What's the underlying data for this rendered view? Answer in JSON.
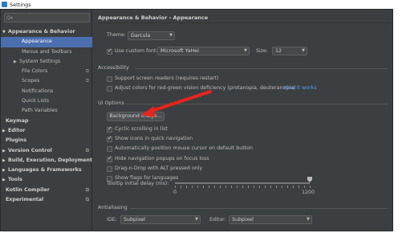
{
  "window": {
    "title": "Settings"
  },
  "search": {
    "placeholder": "Q▾"
  },
  "sidebar": {
    "items": [
      {
        "label": "Appearance & Behavior",
        "arrow": "▼",
        "level": 0,
        "bold": true
      },
      {
        "label": "Appearance",
        "level": 1,
        "selected": true
      },
      {
        "label": "Menus and Toolbars",
        "level": 1
      },
      {
        "label": "System Settings",
        "arrow": "▶",
        "level": 1
      },
      {
        "label": "File Colors",
        "level": 1,
        "project": true
      },
      {
        "label": "Scopes",
        "level": 1,
        "project": true
      },
      {
        "label": "Notifications",
        "level": 1
      },
      {
        "label": "Quick Lists",
        "level": 1
      },
      {
        "label": "Path Variables",
        "level": 1
      },
      {
        "label": "Keymap",
        "level": 0,
        "bold": true
      },
      {
        "label": "Editor",
        "arrow": "▶",
        "level": 0,
        "bold": true
      },
      {
        "label": "Plugins",
        "level": 0,
        "bold": true
      },
      {
        "label": "Version Control",
        "arrow": "▶",
        "level": 0,
        "bold": true,
        "project": true
      },
      {
        "label": "Build, Execution, Deployment",
        "arrow": "▶",
        "level": 0,
        "bold": true
      },
      {
        "label": "Languages & Frameworks",
        "arrow": "▶",
        "level": 0,
        "bold": true
      },
      {
        "label": "Tools",
        "arrow": "▶",
        "level": 0,
        "bold": true
      },
      {
        "label": "Kotlin Compiler",
        "level": 0,
        "bold": true,
        "project": true
      },
      {
        "label": "Experimental",
        "level": 0,
        "bold": true,
        "project": true
      }
    ],
    "project_glyph": "⧉"
  },
  "breadcrumb": {
    "text": "Appearance & Behavior  ›  Appearance"
  },
  "theme": {
    "label": "Theme:",
    "value": "Darcula"
  },
  "custom_font": {
    "label": "Use custom font:",
    "checked": true,
    "value": "Microsoft YaHei",
    "size_label": "Size:",
    "size_value": "12"
  },
  "accessibility": {
    "title": "Accessibility",
    "screen_readers": {
      "label": "Support screen readers (requires restart)",
      "checked": false
    },
    "color_deficiency": {
      "label": "Adjust colors for red-green vision deficiency (protanopia, deuteranopia)",
      "checked": false
    },
    "how_it_works": "How it works"
  },
  "ui_options": {
    "title": "UI Options",
    "background_button": "Background Image...",
    "options": [
      {
        "label": "Cyclic scrolling in list",
        "checked": true
      },
      {
        "label": "Show icons in quick navigation",
        "checked": true
      },
      {
        "label": "Automatically position mouse cursor on default button",
        "checked": false
      },
      {
        "label": "Hide navigation popups on focus loss",
        "checked": true
      },
      {
        "label": "Drag-n-Drop with ALT pressed only",
        "checked": false
      },
      {
        "label": "Show flags for languages",
        "checked": false
      }
    ],
    "tooltip": {
      "label": "Tooltip initial delay (ms):",
      "min": "0",
      "max": "1200",
      "value_fraction": 1.0
    }
  },
  "antialiasing": {
    "title": "Antialiasing",
    "ide_label": "IDE:",
    "ide_value": "Subpixel",
    "editor_label": "Editor:",
    "editor_value": "Subpixel"
  },
  "colors": {
    "selection": "#4b6eaf",
    "link": "#589df6",
    "annotation_arrow": "#e8241c"
  }
}
